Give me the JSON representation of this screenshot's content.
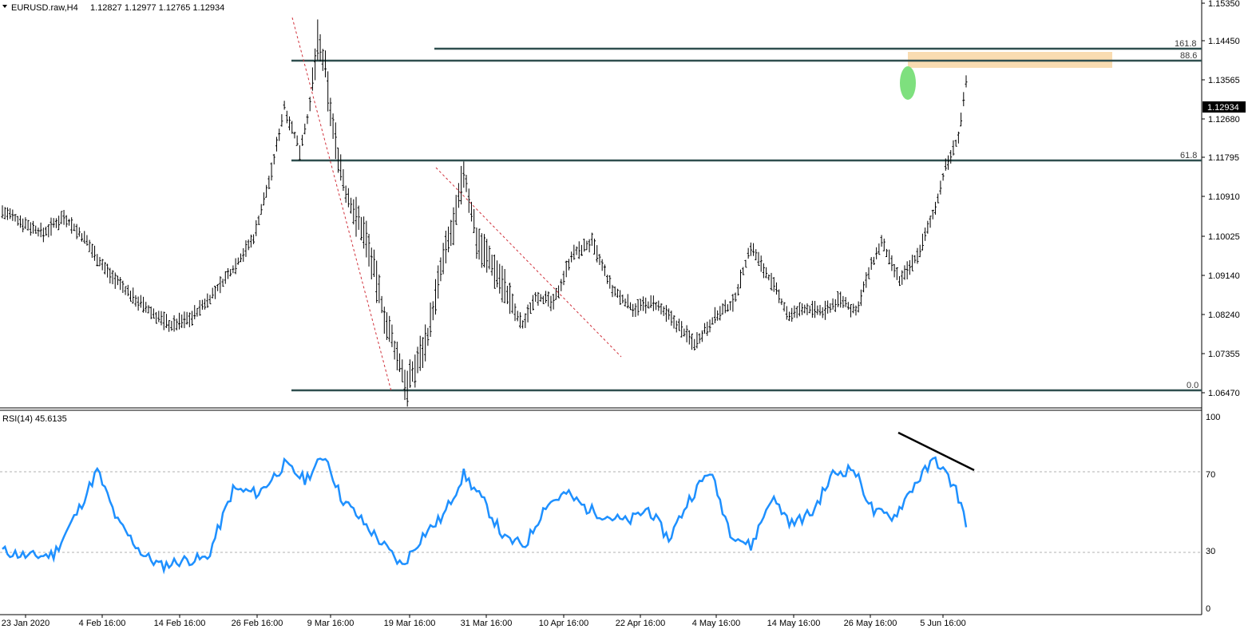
{
  "header": {
    "symbol": "EURUSD.raw,H4",
    "ohlc": "1.12827 1.12977 1.12765 1.12934"
  },
  "price_axis": {
    "ticks": [
      "1.15350",
      "1.14450",
      "1.13565",
      "1.12680",
      "1.11795",
      "1.10910",
      "1.10025",
      "1.09140",
      "1.08240",
      "1.07355",
      "1.06470"
    ],
    "current_price": "1.12934"
  },
  "fib_levels": [
    {
      "label": "161.8",
      "price": 1.1425
    },
    {
      "label": "88.6",
      "price": 1.1399
    },
    {
      "label": "61.8",
      "price": 1.1178
    },
    {
      "label": "0.0",
      "price": 1.0647
    }
  ],
  "rsi": {
    "title": "RSI(14) 45.6135",
    "ticks": [
      "100",
      "70",
      "30",
      "0"
    ]
  },
  "time_axis": {
    "labels": [
      "23 Jan 2020",
      "4 Feb 16:00",
      "14 Feb 16:00",
      "26 Feb 16:00",
      "9 Mar 16:00",
      "19 Mar 16:00",
      "31 Mar 16:00",
      "10 Apr 16:00",
      "22 Apr 16:00",
      "4 May 16:00",
      "14 May 16:00",
      "26 May 16:00",
      "5 Jun 16:00"
    ]
  },
  "colors": {
    "bars": "#000000",
    "level_line": "#2f4f4f",
    "rsi_line": "#1e90ff",
    "zone": "#f8d8a8",
    "highlight": "#7ee07e",
    "trend_dash": "#d0303a"
  },
  "chart_data": [
    {
      "type": "line",
      "description": "EURUSD H4 price path (approximate close values at bar index)",
      "x": [
        0,
        8,
        16,
        24,
        33,
        40,
        50,
        58,
        66,
        74,
        82,
        90,
        98,
        105,
        110,
        116,
        120,
        123,
        126,
        129,
        134,
        142,
        150,
        158,
        166,
        172,
        177,
        180,
        185,
        190,
        195,
        200,
        203,
        208,
        215,
        222,
        230,
        238,
        246,
        254,
        262,
        270,
        278,
        285,
        292,
        300,
        307,
        313,
        320,
        327,
        333,
        338,
        343,
        350,
        357,
        363,
        368,
        373,
        376
      ],
      "y": [
        1.106,
        1.1035,
        1.101,
        1.105,
        1.099,
        1.093,
        1.087,
        1.083,
        1.08,
        1.082,
        1.087,
        1.093,
        1.1,
        1.115,
        1.13,
        1.12,
        1.13,
        1.145,
        1.138,
        1.125,
        1.11,
        1.1,
        1.08,
        1.066,
        1.078,
        1.095,
        1.105,
        1.115,
        1.1,
        1.095,
        1.09,
        1.083,
        1.08,
        1.087,
        1.085,
        1.096,
        1.099,
        1.088,
        1.084,
        1.085,
        1.081,
        1.076,
        1.082,
        1.085,
        1.098,
        1.09,
        1.082,
        1.084,
        1.083,
        1.086,
        1.083,
        1.092,
        1.099,
        1.09,
        1.096,
        1.105,
        1.116,
        1.123,
        1.135
      ],
      "ylim": [
        1.0647,
        1.1535
      ]
    },
    {
      "type": "line",
      "description": "RSI(14) oscillator",
      "x": [
        0,
        10,
        20,
        30,
        37,
        45,
        55,
        62,
        70,
        80,
        90,
        100,
        110,
        118,
        126,
        132,
        140,
        148,
        156,
        164,
        172,
        180,
        188,
        196,
        204,
        212,
        220,
        228,
        236,
        244,
        252,
        260,
        268,
        276,
        284,
        292,
        300,
        308,
        316,
        324,
        332,
        340,
        348,
        356,
        364,
        372,
        376
      ],
      "y": [
        30,
        27,
        28,
        52,
        72,
        45,
        28,
        22,
        25,
        26,
        62,
        60,
        75,
        67,
        80,
        58,
        46,
        34,
        22,
        38,
        48,
        70,
        55,
        36,
        33,
        54,
        60,
        52,
        48,
        45,
        52,
        36,
        57,
        72,
        40,
        32,
        58,
        44,
        50,
        70,
        73,
        50,
        48,
        65,
        78,
        62,
        45
      ],
      "ylim": [
        0,
        100
      ]
    }
  ]
}
